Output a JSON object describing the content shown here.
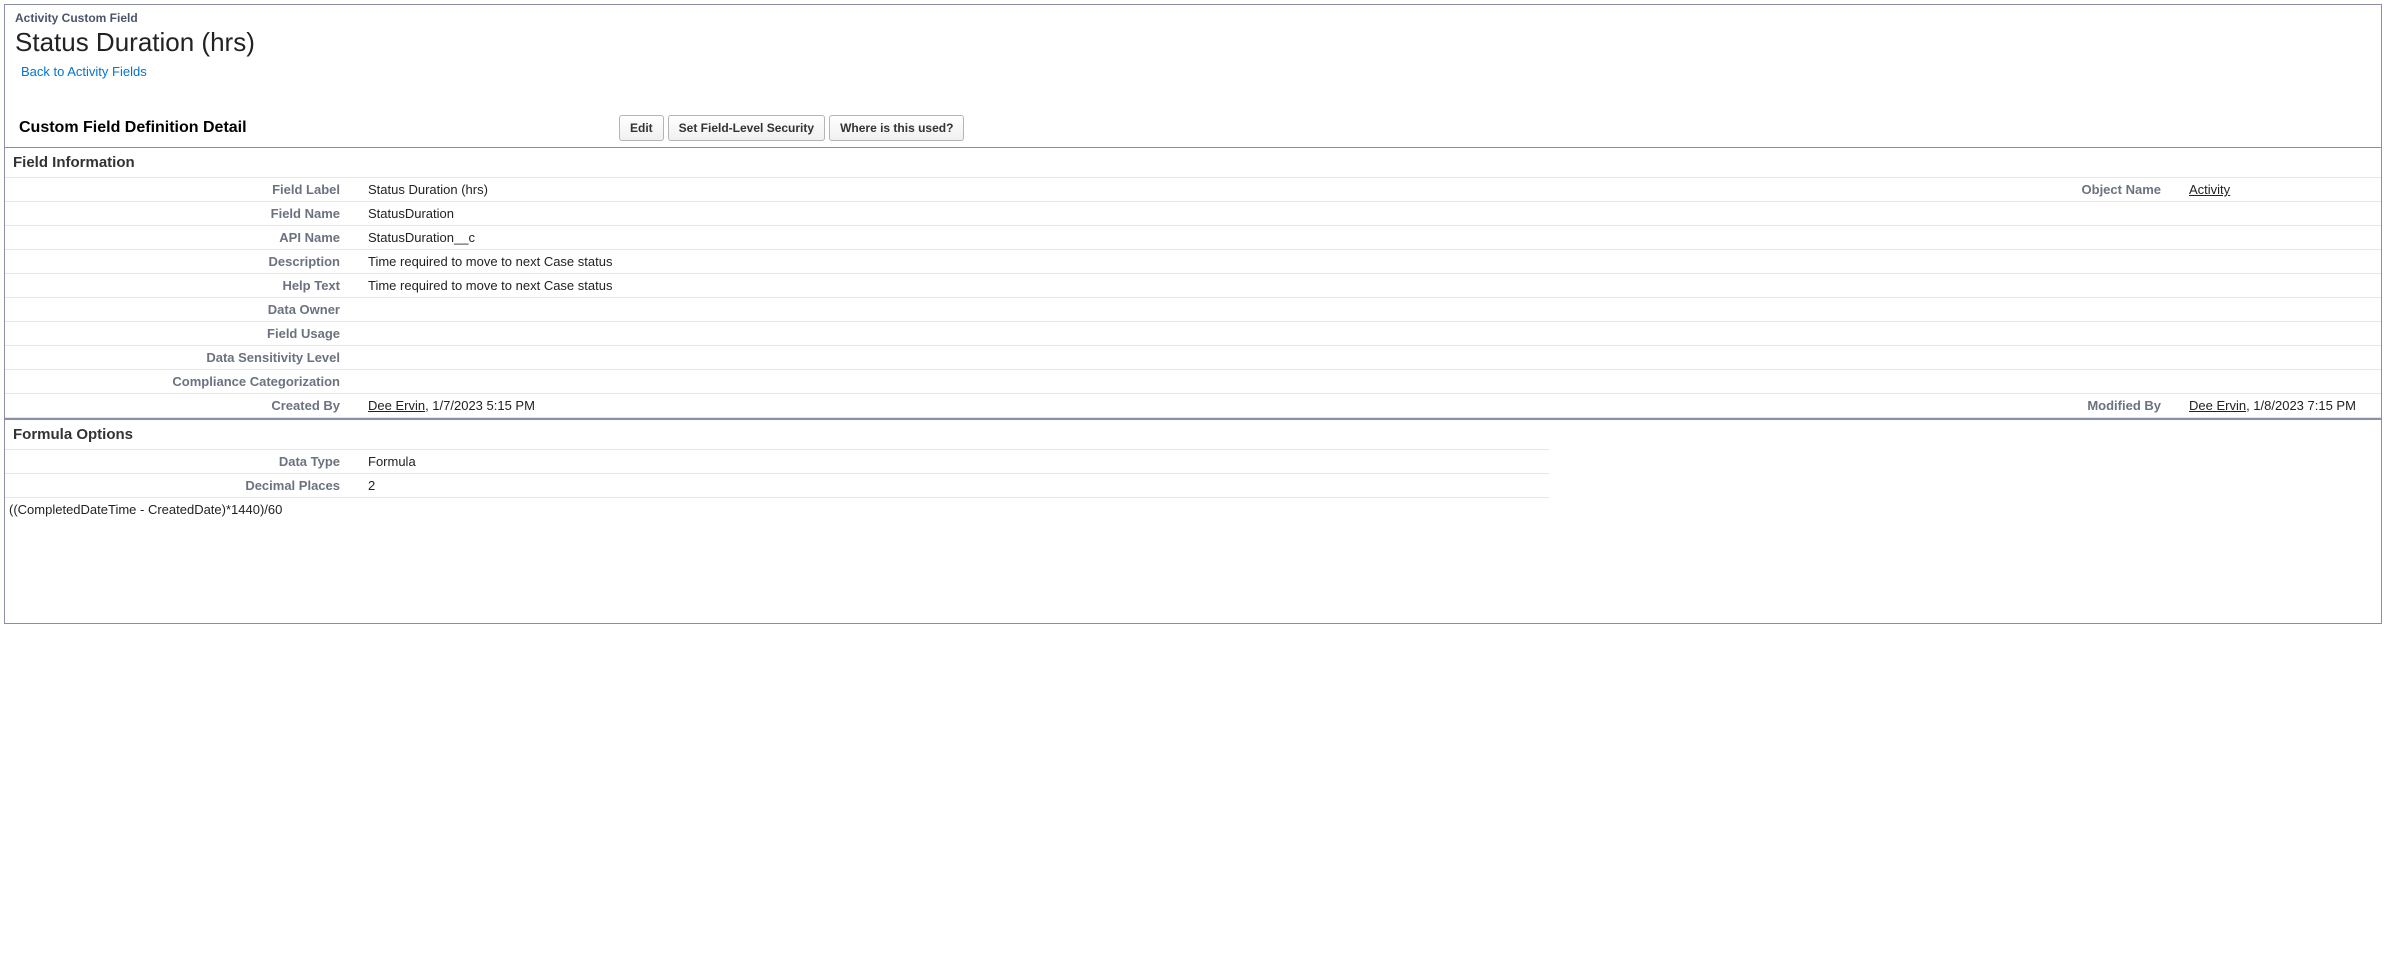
{
  "header": {
    "breadcrumb": "Activity Custom Field",
    "title": "Status Duration (hrs)",
    "back_link": "Back to Activity Fields"
  },
  "section_header": {
    "title": "Custom Field Definition Detail",
    "buttons": {
      "edit": "Edit",
      "set_fls": "Set Field-Level Security",
      "where_used": "Where is this used?"
    }
  },
  "field_info": {
    "section_title": "Field Information",
    "labels": {
      "field_label": "Field Label",
      "object_name": "Object Name",
      "field_name": "Field Name",
      "api_name": "API Name",
      "description": "Description",
      "help_text": "Help Text",
      "data_owner": "Data Owner",
      "field_usage": "Field Usage",
      "data_sensitivity": "Data Sensitivity Level",
      "compliance": "Compliance Categorization",
      "created_by": "Created By",
      "modified_by": "Modified By"
    },
    "values": {
      "field_label": "Status Duration (hrs)",
      "object_name": "Activity",
      "field_name": "StatusDuration",
      "api_name": "StatusDuration__c",
      "description": "Time required to move to next Case status",
      "help_text": "Time required to move to next Case status",
      "data_owner": "",
      "field_usage": "",
      "data_sensitivity": "",
      "compliance": "",
      "created_by_user": "Dee Ervin",
      "created_by_date": ", 1/7/2023 5:15 PM",
      "modified_by_user": "Dee Ervin",
      "modified_by_date": ", 1/8/2023 7:15 PM"
    }
  },
  "formula_options": {
    "section_title": "Formula Options",
    "labels": {
      "data_type": "Data Type",
      "decimal_places": "Decimal Places"
    },
    "values": {
      "data_type": "Formula",
      "decimal_places": "2"
    },
    "formula": "((CompletedDateTime - CreatedDate)*1440)/60"
  }
}
